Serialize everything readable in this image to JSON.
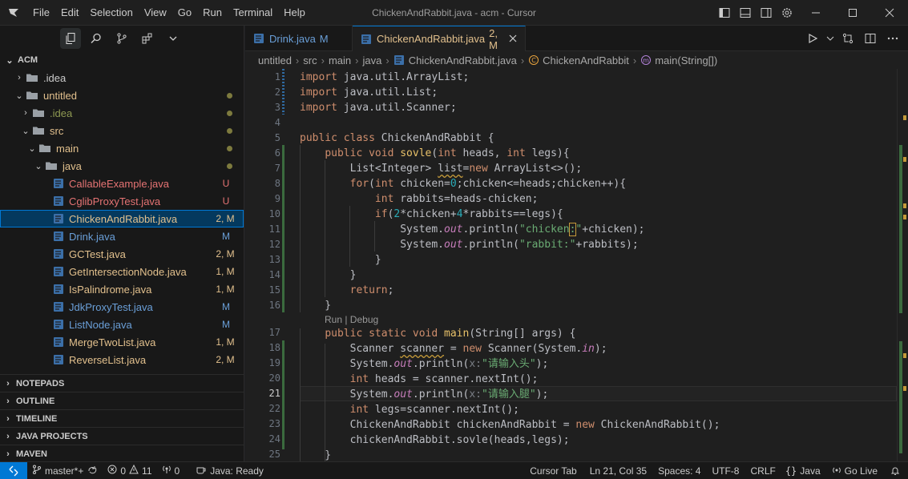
{
  "window": {
    "title": "ChickenAndRabbit.java - acm - Cursor",
    "menu": [
      "File",
      "Edit",
      "Selection",
      "View",
      "Go",
      "Run",
      "Terminal",
      "Help"
    ]
  },
  "explorer": {
    "root": "ACM",
    "items": [
      {
        "label": ".idea",
        "type": "folder",
        "depth": 1,
        "expanded": false,
        "color": "#cccccc"
      },
      {
        "label": "untitled",
        "type": "folder",
        "depth": 1,
        "expanded": true,
        "color": "#e2c08d",
        "dot": true
      },
      {
        "label": ".idea",
        "type": "folder",
        "depth": 2,
        "expanded": false,
        "color": "#8f9a52",
        "dot": true
      },
      {
        "label": "src",
        "type": "folder",
        "depth": 2,
        "expanded": true,
        "color": "#e2c08d",
        "dot": true
      },
      {
        "label": "main",
        "type": "folder",
        "depth": 3,
        "expanded": true,
        "color": "#e2c08d",
        "dot": true
      },
      {
        "label": "java",
        "type": "folder",
        "depth": 4,
        "expanded": true,
        "color": "#e2c08d",
        "dot": true
      },
      {
        "label": "CallableExample.java",
        "type": "file",
        "color": "#e57373",
        "badge": "U",
        "badge_color": "#e57373"
      },
      {
        "label": "CglibProxyTest.java",
        "type": "file",
        "color": "#e57373",
        "badge": "U",
        "badge_color": "#e57373"
      },
      {
        "label": "ChickenAndRabbit.java",
        "type": "file",
        "color": "#e2c08d",
        "badge": "2, M",
        "badge_color": "#e2c08d",
        "selected": true
      },
      {
        "label": "Drink.java",
        "type": "file",
        "color": "#6a9fd8",
        "badge": "M",
        "badge_color": "#6a9fd8"
      },
      {
        "label": "GCTest.java",
        "type": "file",
        "color": "#e2c08d",
        "badge": "2, M",
        "badge_color": "#e2c08d"
      },
      {
        "label": "GetIntersectionNode.java",
        "type": "file",
        "color": "#e2c08d",
        "badge": "1, M",
        "badge_color": "#e2c08d"
      },
      {
        "label": "IsPalindrome.java",
        "type": "file",
        "color": "#e2c08d",
        "badge": "1, M",
        "badge_color": "#e2c08d"
      },
      {
        "label": "JdkProxyTest.java",
        "type": "file",
        "color": "#6a9fd8",
        "badge": "M",
        "badge_color": "#6a9fd8"
      },
      {
        "label": "ListNode.java",
        "type": "file",
        "color": "#6a9fd8",
        "badge": "M",
        "badge_color": "#6a9fd8"
      },
      {
        "label": "MergeTwoList.java",
        "type": "file",
        "color": "#e2c08d",
        "badge": "1, M",
        "badge_color": "#e2c08d"
      },
      {
        "label": "ReverseList.java",
        "type": "file",
        "color": "#e2c08d",
        "badge": "2, M",
        "badge_color": "#e2c08d"
      }
    ],
    "sections": [
      "NOTEPADS",
      "OUTLINE",
      "TIMELINE",
      "JAVA PROJECTS",
      "MAVEN"
    ]
  },
  "tabs": [
    {
      "label": "Drink.java",
      "status": "M",
      "active": false
    },
    {
      "label": "ChickenAndRabbit.java",
      "status": "2, M",
      "active": true
    }
  ],
  "breadcrumb": [
    "untitled",
    "src",
    "main",
    "java",
    "ChickenAndRabbit.java",
    "ChickenAndRabbit",
    "main(String[])"
  ],
  "codelens": "Run | Debug",
  "line_numbers": [
    "1",
    "2",
    "3",
    "4",
    "5",
    "6",
    "7",
    "8",
    "9",
    "10",
    "11",
    "12",
    "13",
    "14",
    "15",
    "16",
    "17",
    "18",
    "19",
    "20",
    "21",
    "22",
    "23",
    "24",
    "25"
  ],
  "current_line": "21",
  "statusbar": {
    "branch": "master*+",
    "errors": "0",
    "warnings": "11",
    "ports": "0",
    "java_status": "Java: Ready",
    "cursor_tab": "Cursor Tab",
    "position": "Ln 21, Col 35",
    "spaces": "Spaces: 4",
    "encoding": "UTF-8",
    "eol": "CRLF",
    "language": "Java",
    "go_live": "Go Live"
  }
}
